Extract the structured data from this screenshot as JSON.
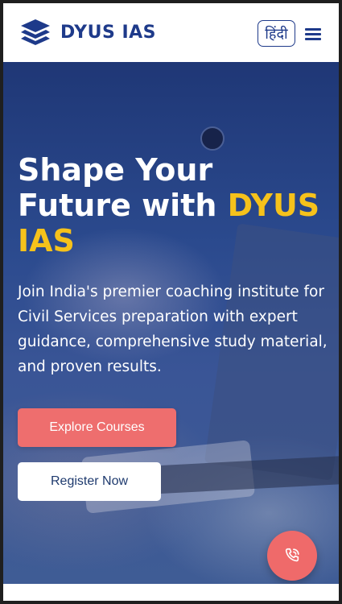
{
  "header": {
    "brand": "DYUS IAS",
    "logo_icon": "stacked-layers-icon",
    "language_button": "हिंदी",
    "menu_icon": "hamburger-menu-icon"
  },
  "hero": {
    "title_line1": "Shape Your",
    "title_line2_prefix": "Future with ",
    "title_accent_1": "DYUS",
    "title_accent_2": "IAS",
    "description": "Join India's premier coaching institute for Civil Services preparation with expert guidance, comprehensive study material, and proven results.",
    "primary_button": "Explore Courses",
    "secondary_button": "Register Now"
  },
  "fab": {
    "icon": "phone-call-icon"
  },
  "colors": {
    "brand_blue": "#1e3a8a",
    "accent_yellow": "#f6c21b",
    "coral": "#ee6e6e"
  }
}
